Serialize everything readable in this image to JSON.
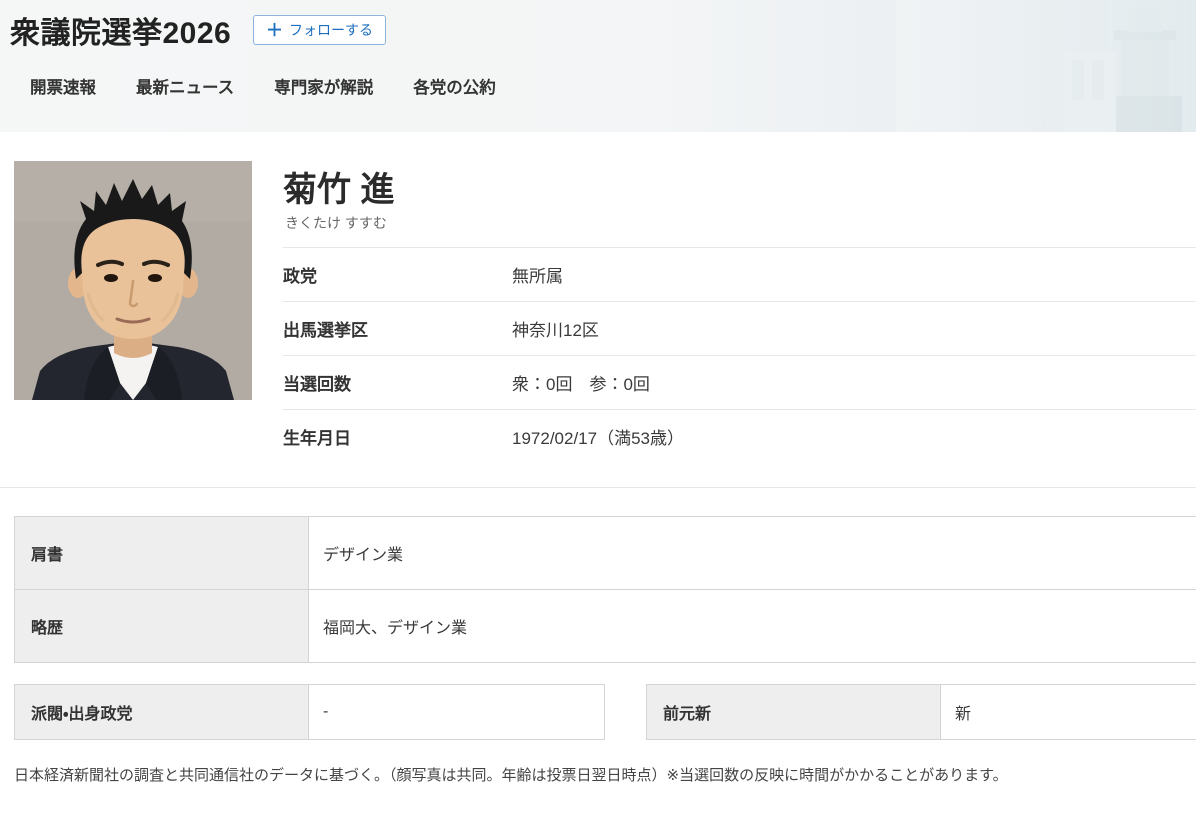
{
  "header": {
    "title": "衆議院選挙2026",
    "follow_plus": "＋",
    "follow_label": "フォローする",
    "nav": [
      {
        "label": "開票速報"
      },
      {
        "label": "最新ニュース"
      },
      {
        "label": "専門家が解説"
      },
      {
        "label": "各党の公約"
      }
    ]
  },
  "candidate": {
    "name": "菊竹 進",
    "furigana": "きくたけ すすむ",
    "profile_rows": [
      {
        "label": "政党",
        "value": "無所属"
      },
      {
        "label": "出馬選挙区",
        "value": "神奈川12区"
      },
      {
        "label": "当選回数",
        "value": "衆：0回　参：0回"
      },
      {
        "label": "生年月日",
        "value": "1972/02/17（満53歳）"
      }
    ]
  },
  "career_table": {
    "rows": [
      {
        "label": "肩書",
        "value": "デザイン業"
      },
      {
        "label": "略歴",
        "value": "福岡大、デザイン業"
      }
    ]
  },
  "faction_table": {
    "label": "派閥・出身政党",
    "value": "-"
  },
  "status_table": {
    "label": "前元新",
    "value": "新"
  },
  "footer": {
    "note": "日本経済新聞社の調査と共同通信社のデータに基づく。（顔写真は共同。年齢は投票日翌日時点）※当選回数の反映に時間がかかることがあります。"
  },
  "colors": {
    "accent_blue": "#1c6fbe",
    "photo_background": "#b2aba3",
    "label_cell_background": "#eeeeee"
  }
}
